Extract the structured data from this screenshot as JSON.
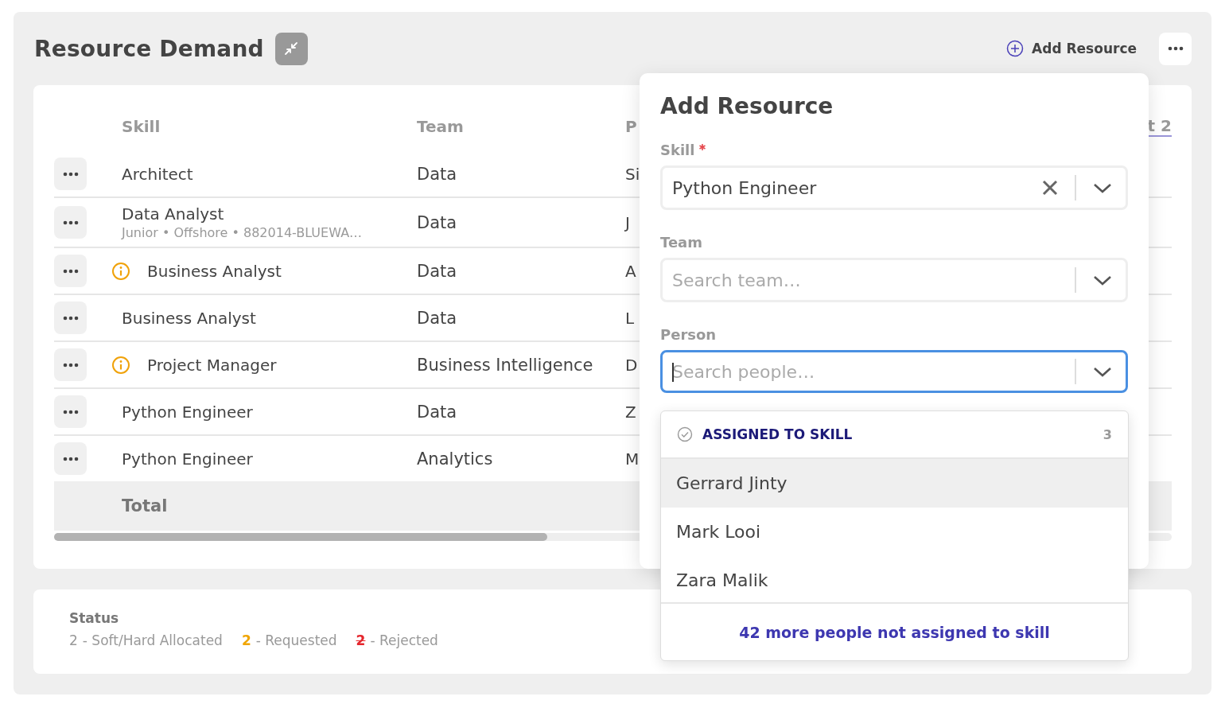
{
  "header": {
    "title": "Resource Demand",
    "add_label": "Add Resource"
  },
  "table": {
    "columns": [
      "Skill",
      "Team",
      "P",
      "t 2"
    ],
    "rows": [
      {
        "skill": "Architect",
        "warning": false,
        "team": "Data",
        "column_3": "Si"
      },
      {
        "skill": "Data Analyst",
        "subtitle": "Junior • Offshore • 882014-BLUEWA…",
        "warning": false,
        "team": "Data",
        "column_3": "J"
      },
      {
        "skill": "Business Analyst",
        "warning": true,
        "team": "Data",
        "column_3": "A"
      },
      {
        "skill": "Business Analyst",
        "warning": false,
        "team": "Data",
        "column_3": "L"
      },
      {
        "skill": "Project Manager",
        "warning": true,
        "team": "Business Intelligence",
        "column_3": "D"
      },
      {
        "skill": "Python Engineer",
        "warning": false,
        "team": "Data",
        "column_3": "Z"
      },
      {
        "skill": "Python Engineer",
        "warning": false,
        "team": "Analytics",
        "column_3": "M"
      }
    ],
    "total_label": "Total"
  },
  "status": {
    "title": "Status",
    "items": [
      {
        "kind": "allocated",
        "count": "2",
        "label": "- Soft/Hard Allocated"
      },
      {
        "kind": "requested",
        "count": "2",
        "label": "- Requested"
      },
      {
        "kind": "rejected",
        "count": "2",
        "label": "- Rejected"
      }
    ]
  },
  "add_resource": {
    "title": "Add Resource",
    "fields": [
      {
        "label": "Skill",
        "required": true,
        "value": "Python Engineer",
        "focused": false
      },
      {
        "label": "Team",
        "required": false,
        "placeholder": "Search team…",
        "focused": false
      },
      {
        "label": "Person",
        "required": false,
        "placeholder": "Search people…",
        "focused": true
      }
    ],
    "dropdown": {
      "group": "ASSIGNED TO SKILL",
      "count": "3",
      "options": [
        {
          "name": "Gerrard Jinty",
          "highlighted": true
        },
        {
          "name": "Mark Looi",
          "highlighted": false
        },
        {
          "name": "Zara Malik",
          "highlighted": false
        }
      ],
      "more_link": "42 more people not assigned to skill"
    }
  }
}
